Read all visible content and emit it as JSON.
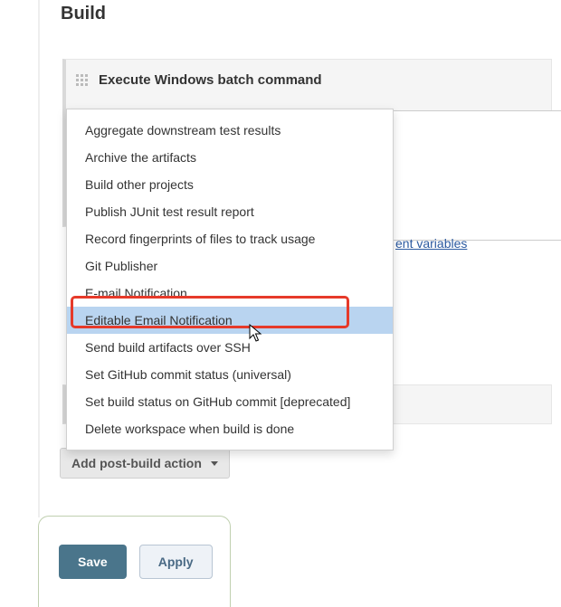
{
  "section": {
    "title": "Build"
  },
  "step": {
    "title": "Execute Windows batch command"
  },
  "link": {
    "env_variables": "ent variables"
  },
  "buttons": {
    "add_post_build": "Add post-build action",
    "save": "Save",
    "apply": "Apply"
  },
  "dropdown": {
    "items": [
      "Aggregate downstream test results",
      "Archive the artifacts",
      "Build other projects",
      "Publish JUnit test result report",
      "Record fingerprints of files to track usage",
      "Git Publisher",
      "E-mail Notification",
      "Editable Email Notification",
      "Send build artifacts over SSH",
      "Set GitHub commit status (universal)",
      "Set build status on GitHub commit [deprecated]",
      "Delete workspace when build is done"
    ],
    "hovered_index": 7,
    "highlighted_index": 7
  }
}
